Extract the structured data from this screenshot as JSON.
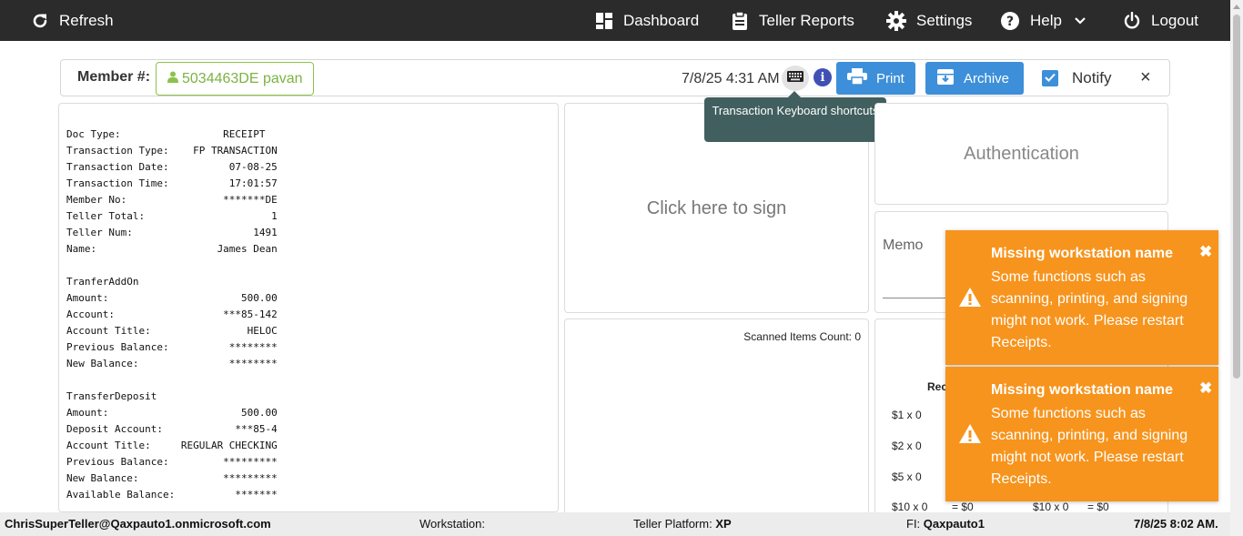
{
  "nav": {
    "refresh": "Refresh",
    "dashboard": "Dashboard",
    "teller_reports": "Teller Reports",
    "settings": "Settings",
    "help": "Help",
    "logout": "Logout"
  },
  "member": {
    "label": "Member #:",
    "value": "5034463DE pavan",
    "datetime": "7/8/25 4:31 AM",
    "print": "Print",
    "archive": "Archive",
    "notify": "Notify",
    "notify_checked": true,
    "close": "×"
  },
  "tooltip": {
    "text": "Transaction Keyboard shortcuts"
  },
  "receipt": {
    "lines": [
      "Doc Type:                 RECEIPT",
      "Transaction Type:    FP TRANSACTION",
      "Transaction Date:          07-08-25",
      "Transaction Time:          17:01:57",
      "Member No:                *******DE",
      "Teller Total:                     1",
      "Teller Num:                    1491",
      "Name:                    James Dean",
      "",
      "TranferAddOn",
      "Amount:                      500.00",
      "Account:                  ***85-142",
      "Account Title:                HELOC",
      "Previous Balance:          ********",
      "New Balance:               ********",
      "",
      "TransferDeposit",
      "Amount:                      500.00",
      "Deposit Account:            ***85-4",
      "Account Title:     REGULAR CHECKING",
      "Previous Balance:         *********",
      "New Balance:              *********",
      "Available Balance:          *******"
    ]
  },
  "sign": {
    "text": "Click here to sign"
  },
  "auth": {
    "text": "Authentication"
  },
  "memo": {
    "label": "Memo"
  },
  "scanned": {
    "label": "Scanned Items Count: 0"
  },
  "cash": {
    "heading": "Rec",
    "rows": [
      "$1 x 0",
      "$2 x 0",
      "$5 x 0",
      "$10 x 0"
    ],
    "row_sum": "= $0",
    "extra_denom": "$10 x 0",
    "extra_sum": "= $0"
  },
  "toasts": [
    {
      "title": "Missing workstation name",
      "message": "Some functions such as scanning, printing, and signing might not work. Please restart Receipts.",
      "close": "✖"
    },
    {
      "title": "Missing workstation name",
      "message": "Some functions such as scanning, printing, and signing might not work. Please restart Receipts.",
      "close": "✖"
    }
  ],
  "footer": {
    "user": "ChrisSuperTeller@Qaxpauto1.onmicrosoft.com",
    "workstation_label": "Workstation:",
    "platform_label": "Teller Platform:",
    "platform_value": "XP",
    "fi_label": "FI:",
    "fi_value": "Qaxpauto1",
    "time": "7/8/25 8:02 AM."
  },
  "colors": {
    "nav_bg": "#2b2b2b",
    "accent_blue": "#3d8fd9",
    "member_green": "#7cb342",
    "toast_orange": "#f7941d",
    "tooltip_bg": "#415f5f"
  }
}
